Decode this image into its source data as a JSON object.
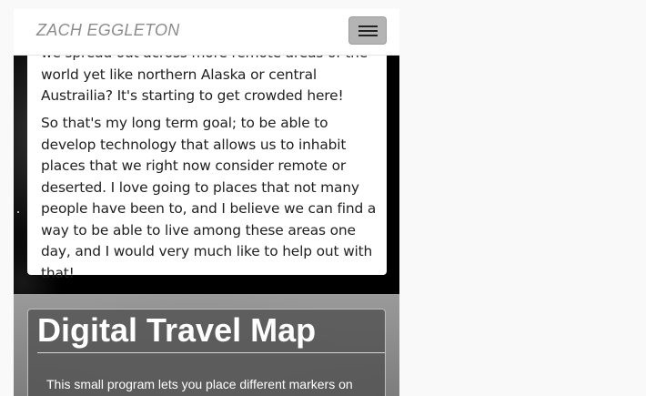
{
  "navbar": {
    "brand": "ZACH EGGLETON",
    "menu_icon": "hamburger-menu-icon"
  },
  "about": {
    "paragraph1": "we spread out across more remote areas of the world yet like northern Alaska or central Austrailia? It's starting to get crowded here!",
    "paragraph2": "So that's my long term goal; to be able to develop technology that allows us to inhabit places that we right now consider remote or deserted. I love going to places that not many people have been to, and I believe we can find a way to be able to live among these areas one day, and I would very much like to help out with that!"
  },
  "project": {
    "title": "Digital Travel Map",
    "description": "This small program lets you place different markers on"
  }
}
